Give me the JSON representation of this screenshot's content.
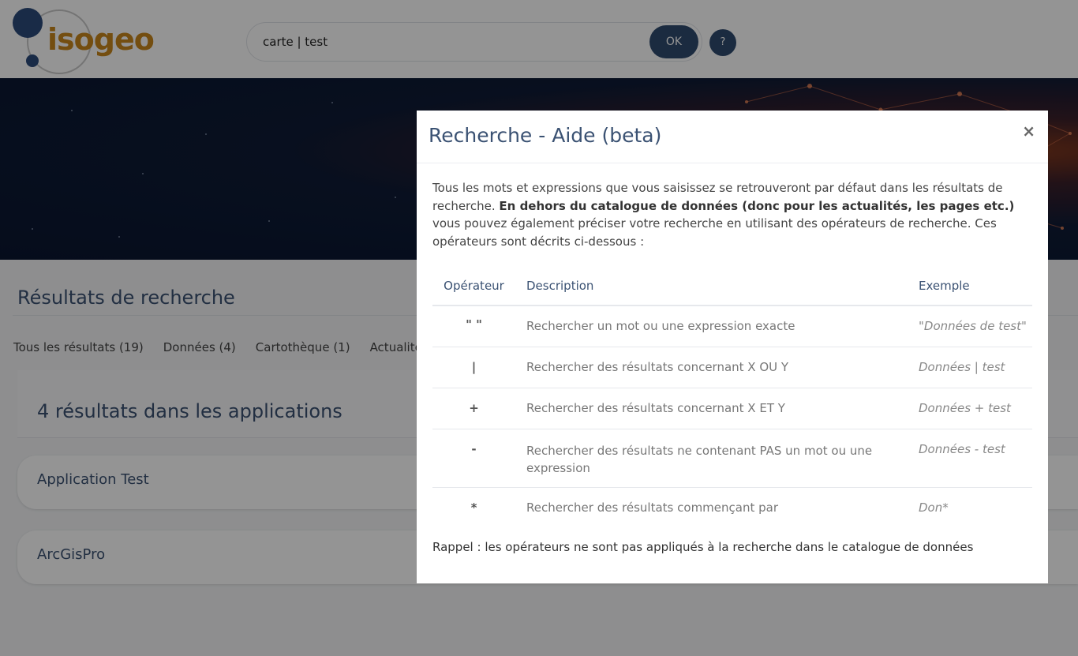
{
  "logo": {
    "text": "isogeo"
  },
  "search": {
    "value": "carte | test",
    "ok_label": "OK",
    "help_label": "?"
  },
  "page": {
    "results_title": "Résultats de recherche",
    "tabs": [
      {
        "label": "Tous les résultats (19)"
      },
      {
        "label": "Données (4)"
      },
      {
        "label": "Cartothèque (1)"
      },
      {
        "label": "Actualités"
      }
    ],
    "section_title": "4 résultats dans les applications",
    "cards": [
      {
        "label": "Application Test"
      },
      {
        "label": "ArcGisPro"
      }
    ]
  },
  "modal": {
    "title": "Recherche - Aide (beta)",
    "close": "×",
    "intro_part1": "Tous les mots et expressions que vous saisissez se retrouveront par défaut dans les résultats de recherche.",
    "intro_bold": "En dehors du catalogue de données (donc pour les actualités, les pages etc.)",
    "intro_part2": "vous pouvez également préciser votre recherche en utilisant des opérateurs de recherche. Ces opérateurs sont décrits ci-dessous :",
    "columns": {
      "operator": "Opérateur",
      "description": "Description",
      "example": "Exemple"
    },
    "rows": [
      {
        "op": "\" \"",
        "desc": "Rechercher un mot ou une expression exacte",
        "example": "\"Données de test\""
      },
      {
        "op": "|",
        "desc": "Rechercher des résultats concernant X OU Y",
        "example": "Données | test"
      },
      {
        "op": "+",
        "desc": "Rechercher des résultats concernant X ET Y",
        "example": "Données + test"
      },
      {
        "op": "-",
        "desc": "Rechercher des résultats ne contenant PAS un mot ou une expression",
        "example": "Données - test"
      },
      {
        "op": "*",
        "desc": "Rechercher des résultats commençant par",
        "example": "Don*"
      }
    ],
    "reminder": "Rappel : les opérateurs ne sont pas appliqués à la recherche dans le catalogue de données"
  }
}
